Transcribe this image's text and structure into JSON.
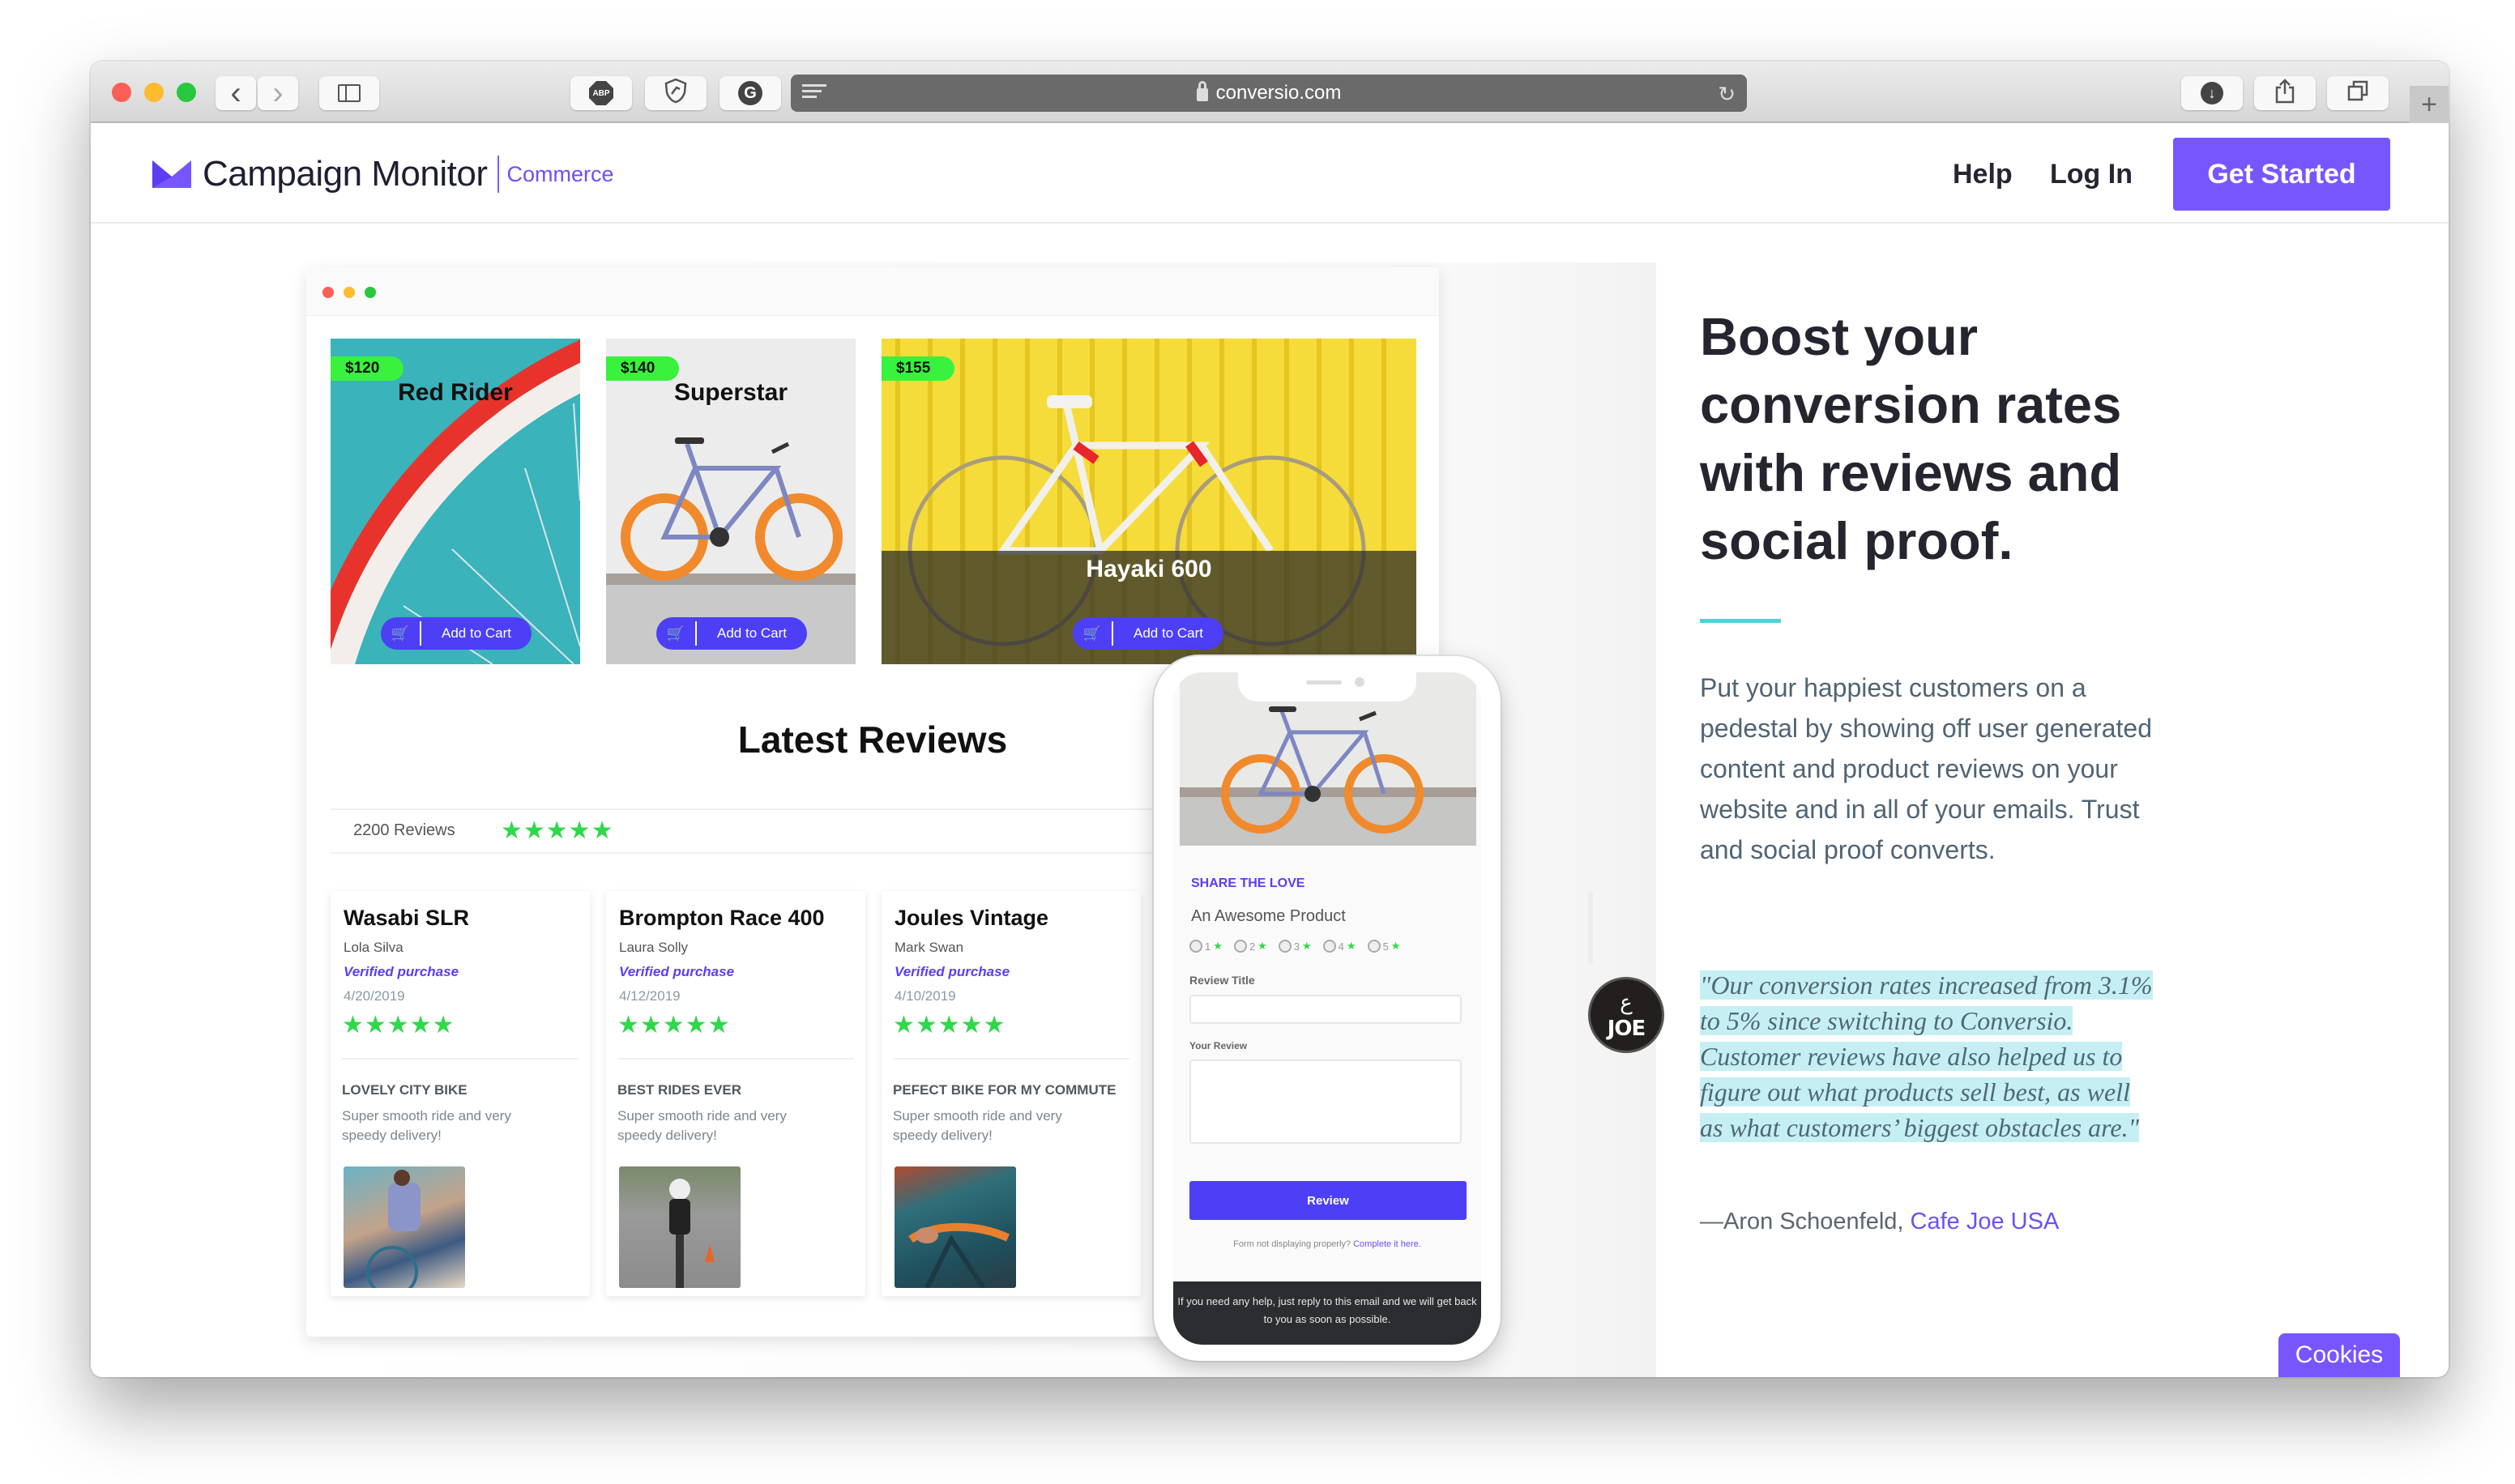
{
  "browser": {
    "url": "conversio.com",
    "toolbar_icons": [
      "back-icon",
      "forward-icon",
      "sidebar-icon",
      "adblock-plus-icon",
      "shield-extension-icon",
      "grammarly-icon",
      "reader-icon",
      "reload-icon",
      "download-icon",
      "share-icon",
      "tabs-icon",
      "new-tab-icon"
    ],
    "back_glyph": "‹",
    "forward_glyph": "›",
    "abp_label": "ABP",
    "reload_glyph": "↻",
    "new_tab_glyph": "+"
  },
  "header": {
    "brand": "Campaign Monitor",
    "sub_brand": "Commerce",
    "nav": {
      "help": "Help",
      "login": "Log In",
      "cta": "Get Started"
    },
    "colors": {
      "brand_purple": "#7856ff",
      "accent_cyan": "#4fd1dc"
    }
  },
  "mockup": {
    "products": [
      {
        "name": "Red Rider",
        "price": "$120",
        "cart_label": "Add to Cart"
      },
      {
        "name": "Superstar",
        "price": "$140",
        "cart_label": "Add to Cart"
      },
      {
        "name": "Hayaki 600",
        "price": "$155",
        "cart_label": "Add to Cart"
      }
    ],
    "cart_glyph": "🛒",
    "reviews_title": "Latest Reviews",
    "reviews_count": "2200 Reviews",
    "overall_stars": "★★★★★",
    "overall_rating": 5,
    "reviews": [
      {
        "product": "Wasabi SLR",
        "author": "Lola Silva",
        "verified": "Verified purchase",
        "date": "4/20/2019",
        "stars": "★★★★★",
        "rating": 5,
        "headline": "LOVELY CITY BIKE",
        "body": "Super smooth ride and very speedy delivery!"
      },
      {
        "product": "Brompton Race 400",
        "author": "Laura Solly",
        "verified": "Verified purchase",
        "date": "4/12/2019",
        "stars": "★★★★★",
        "rating": 5,
        "headline": "BEST RIDES EVER",
        "body": "Super smooth ride and very speedy delivery!"
      },
      {
        "product": "Joules Vintage",
        "author": "Mark Swan",
        "verified": "Verified purchase",
        "date": "4/10/2019",
        "stars": "★★★★★",
        "rating": 5,
        "headline": "PEFECT BIKE FOR MY COMMUTE",
        "body": "Super smooth ride and very speedy delivery!"
      }
    ]
  },
  "phone": {
    "share_label": "SHARE THE LOVE",
    "product_name": "An Awesome Product",
    "rating_options": [
      "1",
      "2",
      "3",
      "4",
      "5"
    ],
    "star_glyph": "★",
    "review_title_label": "Review Title",
    "review_title_value": "",
    "your_review_label": "Your Review",
    "your_review_value": "",
    "submit_label": "Review",
    "fallback_text": "Form not displaying properly?",
    "fallback_link": "Complete it here.",
    "footer_text": "If you need any help, just reply to this email and we will get back to you as soon as possible."
  },
  "hero": {
    "headline": "Boost your conversion rates with reviews and social proof.",
    "paragraph": "Put your happiest customers on a pedestal by showing off user generated content and product reviews on your website and in all of your emails. Trust and social proof converts.",
    "quote_logo_text": "JOE",
    "quote_logo_symbol": "ﻉ",
    "quote": "\"Our conversion rates increased from 3.1% to 5% since switching to Conversio. Customer reviews have also helped us to figure out what products sell best, as well as what customers’ biggest obstacles are.\"",
    "attribution_person": "—Aron Schoenfeld, ",
    "attribution_company": "Cafe Joe USA"
  },
  "cookies_label": "Cookies"
}
